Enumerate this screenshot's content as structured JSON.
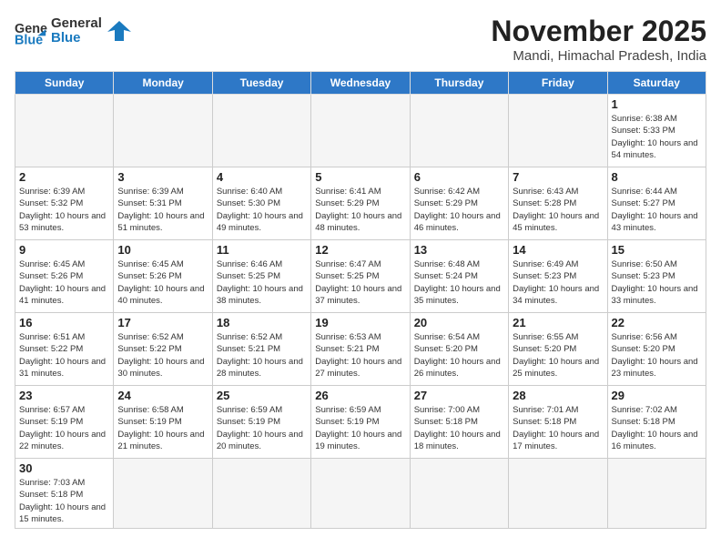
{
  "header": {
    "logo_general": "General",
    "logo_blue": "Blue",
    "month": "November 2025",
    "location": "Mandi, Himachal Pradesh, India"
  },
  "weekdays": [
    "Sunday",
    "Monday",
    "Tuesday",
    "Wednesday",
    "Thursday",
    "Friday",
    "Saturday"
  ],
  "weeks": [
    [
      {
        "day": null
      },
      {
        "day": null
      },
      {
        "day": null
      },
      {
        "day": null
      },
      {
        "day": null
      },
      {
        "day": null
      },
      {
        "day": "1",
        "sunrise": "6:38 AM",
        "sunset": "5:33 PM",
        "daylight": "10 hours and 54 minutes."
      }
    ],
    [
      {
        "day": "2",
        "sunrise": "6:39 AM",
        "sunset": "5:32 PM",
        "daylight": "10 hours and 53 minutes."
      },
      {
        "day": "3",
        "sunrise": "6:39 AM",
        "sunset": "5:31 PM",
        "daylight": "10 hours and 51 minutes."
      },
      {
        "day": "4",
        "sunrise": "6:40 AM",
        "sunset": "5:30 PM",
        "daylight": "10 hours and 49 minutes."
      },
      {
        "day": "5",
        "sunrise": "6:41 AM",
        "sunset": "5:29 PM",
        "daylight": "10 hours and 48 minutes."
      },
      {
        "day": "6",
        "sunrise": "6:42 AM",
        "sunset": "5:29 PM",
        "daylight": "10 hours and 46 minutes."
      },
      {
        "day": "7",
        "sunrise": "6:43 AM",
        "sunset": "5:28 PM",
        "daylight": "10 hours and 45 minutes."
      },
      {
        "day": "8",
        "sunrise": "6:44 AM",
        "sunset": "5:27 PM",
        "daylight": "10 hours and 43 minutes."
      }
    ],
    [
      {
        "day": "9",
        "sunrise": "6:45 AM",
        "sunset": "5:26 PM",
        "daylight": "10 hours and 41 minutes."
      },
      {
        "day": "10",
        "sunrise": "6:45 AM",
        "sunset": "5:26 PM",
        "daylight": "10 hours and 40 minutes."
      },
      {
        "day": "11",
        "sunrise": "6:46 AM",
        "sunset": "5:25 PM",
        "daylight": "10 hours and 38 minutes."
      },
      {
        "day": "12",
        "sunrise": "6:47 AM",
        "sunset": "5:25 PM",
        "daylight": "10 hours and 37 minutes."
      },
      {
        "day": "13",
        "sunrise": "6:48 AM",
        "sunset": "5:24 PM",
        "daylight": "10 hours and 35 minutes."
      },
      {
        "day": "14",
        "sunrise": "6:49 AM",
        "sunset": "5:23 PM",
        "daylight": "10 hours and 34 minutes."
      },
      {
        "day": "15",
        "sunrise": "6:50 AM",
        "sunset": "5:23 PM",
        "daylight": "10 hours and 33 minutes."
      }
    ],
    [
      {
        "day": "16",
        "sunrise": "6:51 AM",
        "sunset": "5:22 PM",
        "daylight": "10 hours and 31 minutes."
      },
      {
        "day": "17",
        "sunrise": "6:52 AM",
        "sunset": "5:22 PM",
        "daylight": "10 hours and 30 minutes."
      },
      {
        "day": "18",
        "sunrise": "6:52 AM",
        "sunset": "5:21 PM",
        "daylight": "10 hours and 28 minutes."
      },
      {
        "day": "19",
        "sunrise": "6:53 AM",
        "sunset": "5:21 PM",
        "daylight": "10 hours and 27 minutes."
      },
      {
        "day": "20",
        "sunrise": "6:54 AM",
        "sunset": "5:20 PM",
        "daylight": "10 hours and 26 minutes."
      },
      {
        "day": "21",
        "sunrise": "6:55 AM",
        "sunset": "5:20 PM",
        "daylight": "10 hours and 25 minutes."
      },
      {
        "day": "22",
        "sunrise": "6:56 AM",
        "sunset": "5:20 PM",
        "daylight": "10 hours and 23 minutes."
      }
    ],
    [
      {
        "day": "23",
        "sunrise": "6:57 AM",
        "sunset": "5:19 PM",
        "daylight": "10 hours and 22 minutes."
      },
      {
        "day": "24",
        "sunrise": "6:58 AM",
        "sunset": "5:19 PM",
        "daylight": "10 hours and 21 minutes."
      },
      {
        "day": "25",
        "sunrise": "6:59 AM",
        "sunset": "5:19 PM",
        "daylight": "10 hours and 20 minutes."
      },
      {
        "day": "26",
        "sunrise": "6:59 AM",
        "sunset": "5:19 PM",
        "daylight": "10 hours and 19 minutes."
      },
      {
        "day": "27",
        "sunrise": "7:00 AM",
        "sunset": "5:18 PM",
        "daylight": "10 hours and 18 minutes."
      },
      {
        "day": "28",
        "sunrise": "7:01 AM",
        "sunset": "5:18 PM",
        "daylight": "10 hours and 17 minutes."
      },
      {
        "day": "29",
        "sunrise": "7:02 AM",
        "sunset": "5:18 PM",
        "daylight": "10 hours and 16 minutes."
      }
    ],
    [
      {
        "day": "30",
        "sunrise": "7:03 AM",
        "sunset": "5:18 PM",
        "daylight": "10 hours and 15 minutes."
      },
      {
        "day": null
      },
      {
        "day": null
      },
      {
        "day": null
      },
      {
        "day": null
      },
      {
        "day": null
      },
      {
        "day": null
      }
    ]
  ]
}
